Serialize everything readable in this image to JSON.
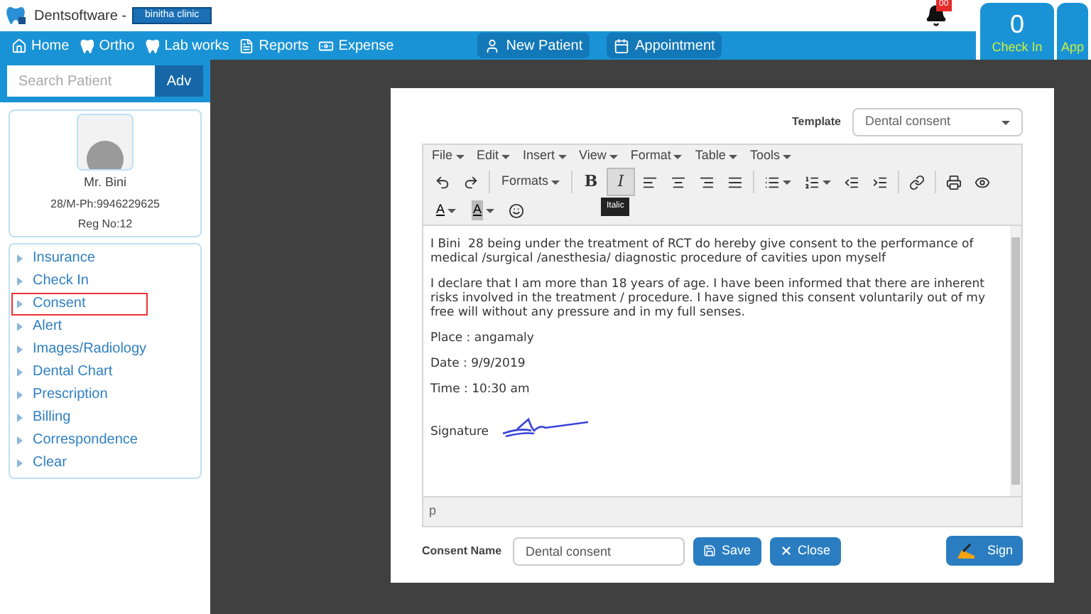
{
  "header": {
    "app_name": "Dentsoftware -",
    "clinic": "binitha clinic",
    "notifications": "00"
  },
  "nav": [
    {
      "kind": "home",
      "label": "Home"
    },
    {
      "kind": "tooth",
      "label": "Ortho"
    },
    {
      "kind": "tooth",
      "label": "Lab works"
    },
    {
      "kind": "file",
      "label": "Reports"
    },
    {
      "kind": "money",
      "label": "Expense"
    }
  ],
  "nav_buttons": [
    {
      "kind": "user",
      "label": "New Patient"
    },
    {
      "kind": "calendar",
      "label": "Appointment"
    }
  ],
  "counters": [
    {
      "count": "0",
      "label": "Check In"
    },
    {
      "label": "App"
    }
  ],
  "search": {
    "placeholder": "Search Patient",
    "button": "Adv"
  },
  "patient": {
    "name": "Mr. Bini",
    "info": "28/M-Ph:9946229625",
    "reg": "Reg No:12"
  },
  "menu": [
    {
      "label": "Insurance",
      "selected": false
    },
    {
      "label": "Check In",
      "selected": false
    },
    {
      "label": "Consent",
      "selected": true
    },
    {
      "label": "Alert",
      "selected": false
    },
    {
      "label": "Images/Radiology",
      "selected": false
    },
    {
      "label": "Dental Chart",
      "selected": false
    },
    {
      "label": "Prescription",
      "selected": false
    },
    {
      "label": "Billing",
      "selected": false
    },
    {
      "label": "Correspondence",
      "selected": false
    },
    {
      "label": "Clear",
      "selected": false
    }
  ],
  "template": {
    "label": "Template",
    "value": "Dental consent"
  },
  "editor": {
    "menus": [
      "File",
      "Edit",
      "Insert",
      "View",
      "Format",
      "Table",
      "Tools"
    ],
    "toolbar": [
      [
        {
          "kind": "undo",
          "active": false
        },
        {
          "kind": "redo",
          "active": false
        },
        {
          "kind": "sep"
        },
        {
          "kind": "text",
          "label": "Formats",
          "active": false
        },
        {
          "kind": "sep"
        },
        {
          "kind": "bold",
          "label": "B",
          "active": false
        },
        {
          "kind": "italic",
          "label": "I",
          "active": true
        },
        {
          "kind": "alignleft",
          "active": false
        },
        {
          "kind": "aligncenter",
          "active": false
        },
        {
          "kind": "alignright",
          "active": false
        },
        {
          "kind": "justify",
          "active": false
        },
        {
          "kind": "sep"
        },
        {
          "kind": "bullets",
          "active": false
        },
        {
          "kind": "numbers",
          "active": false
        },
        {
          "kind": "outdent",
          "active": false
        },
        {
          "kind": "indent",
          "active": false
        },
        {
          "kind": "sep"
        },
        {
          "kind": "link",
          "active": false
        },
        {
          "kind": "sep"
        },
        {
          "kind": "print",
          "active": false
        },
        {
          "kind": "preview",
          "active": false
        }
      ],
      [
        {
          "kind": "textcolor",
          "label": "A",
          "active": false
        },
        {
          "kind": "bgcolor",
          "label": "A",
          "active": false
        },
        {
          "kind": "emoji",
          "active": false
        }
      ]
    ],
    "tooltip": "Italic",
    "paragraphs": [
      "I Bini  28 being under the treatment of RCT do hereby give consent to the performance of medical /surgical /anesthesia/ diagnostic procedure of cavities upon myself",
      "I declare that I am more than 18 years of age. I have been informed that there are inherent risks involved in the treatment / procedure. I have signed this consent voluntarily out of my free will without any pressure and in my full senses.",
      "Place : angamaly",
      "Date : 9/9/2019",
      "Time : 10:30 am"
    ],
    "signature_label": "Signature",
    "status": "p"
  },
  "footer": {
    "label": "Consent Name",
    "value": "Dental consent",
    "save": "Save",
    "close": "Close",
    "sign": "Sign"
  }
}
